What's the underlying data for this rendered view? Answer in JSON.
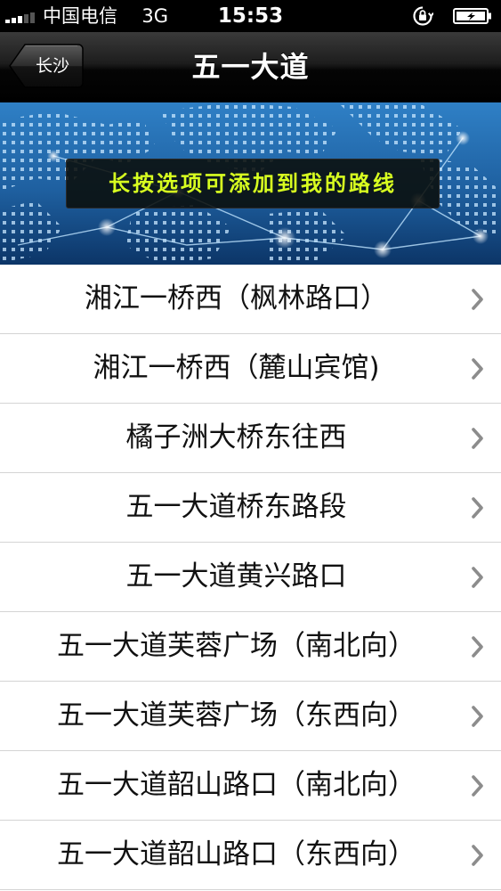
{
  "status_bar": {
    "carrier": "中国电信",
    "network": "3G",
    "time": "15:53"
  },
  "nav": {
    "back_label": "长沙",
    "title": "五一大道"
  },
  "banner": {
    "text": "长按选项可添加到我的路线"
  },
  "list": {
    "items": [
      {
        "label": "湘江一桥西（枫林路口）"
      },
      {
        "label": "湘江一桥西（麓山宾馆)"
      },
      {
        "label": "橘子洲大桥东往西"
      },
      {
        "label": "五一大道桥东路段"
      },
      {
        "label": "五一大道黄兴路口"
      },
      {
        "label": "五一大道芙蓉广场（南北向）"
      },
      {
        "label": "五一大道芙蓉广场（东西向）"
      },
      {
        "label": "五一大道韶山路口（南北向）"
      },
      {
        "label": "五一大道韶山路口（东西向）"
      }
    ]
  },
  "icons": {
    "signal": "signal-bars-icon",
    "lock": "rotation-lock-icon",
    "battery": "battery-charging-icon",
    "back": "back-arrow-button",
    "row_disclosure": "chevron-right-icon"
  },
  "colors": {
    "banner_text": "#d8ff20",
    "nav_background": "#000000",
    "row_text": "#111111",
    "chevron": "#8c8c8c"
  }
}
